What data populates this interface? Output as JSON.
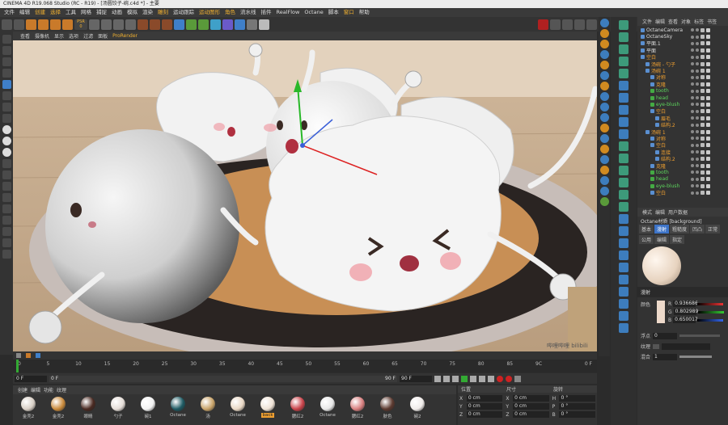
{
  "window": {
    "title": "CINEMA 4D R19.068 Studio (RC - R19) - [汤圆饺子-碗.c4d *] - 主要"
  },
  "menubar": [
    "文件",
    "编辑",
    "创建",
    "选择",
    "工具",
    "网格",
    "捕捉",
    "动画",
    "模拟",
    "渲染",
    "雕刻",
    "运动跟踪",
    "运动图形",
    "角色",
    "流水线",
    "插件",
    "RealFlow",
    "Octane",
    "脚本",
    "窗口",
    "帮助"
  ],
  "menubar_highlight": [
    2,
    3,
    10,
    12,
    13,
    19
  ],
  "toolbar": {
    "psr_label": "PSR",
    "psr_value": "0"
  },
  "viewport": {
    "menu": [
      "查看",
      "摄像机",
      "显示",
      "选项",
      "过滤",
      "面板",
      "ProRender"
    ],
    "menu_highlight": 6,
    "watermark": "哔哩哔哩 bilibili"
  },
  "object_manager": {
    "menu": [
      "文件",
      "编辑",
      "查看",
      "对象",
      "标签",
      "书签"
    ],
    "objects": [
      {
        "name": "OctaneCamera",
        "indent": 0,
        "style": "normal"
      },
      {
        "name": "OctaneSky",
        "indent": 0,
        "style": "normal"
      },
      {
        "name": "平面.1",
        "indent": 0,
        "style": "normal"
      },
      {
        "name": "平面",
        "indent": 0,
        "style": "normal"
      },
      {
        "name": "空白",
        "indent": 0,
        "style": "sel"
      },
      {
        "name": "汤碗 - 勺子",
        "indent": 1,
        "style": "sel"
      },
      {
        "name": "汤碗 1",
        "indent": 1,
        "style": "sel"
      },
      {
        "name": "对称",
        "indent": 2,
        "style": "sel"
      },
      {
        "name": "克隆",
        "indent": 2,
        "style": "sel"
      },
      {
        "name": "tooth",
        "indent": 2,
        "style": "grn"
      },
      {
        "name": "head",
        "indent": 2,
        "style": "grn"
      },
      {
        "name": "eye-blush",
        "indent": 2,
        "style": "grn"
      },
      {
        "name": "空白",
        "indent": 2,
        "style": "sel"
      },
      {
        "name": "眉毛",
        "indent": 3,
        "style": "sel"
      },
      {
        "name": "结构.2",
        "indent": 3,
        "style": "sel"
      },
      {
        "name": "汤碗 1",
        "indent": 1,
        "style": "sel"
      },
      {
        "name": "对称",
        "indent": 2,
        "style": "sel"
      },
      {
        "name": "空白",
        "indent": 2,
        "style": "sel"
      },
      {
        "name": "连接",
        "indent": 3,
        "style": "sel"
      },
      {
        "name": "结构.2",
        "indent": 3,
        "style": "sel"
      },
      {
        "name": "克隆",
        "indent": 2,
        "style": "sel"
      },
      {
        "name": "tooth",
        "indent": 2,
        "style": "grn"
      },
      {
        "name": "head",
        "indent": 2,
        "style": "grn"
      },
      {
        "name": "eye-blush",
        "indent": 2,
        "style": "grn"
      },
      {
        "name": "空白",
        "indent": 2,
        "style": "sel"
      }
    ]
  },
  "attribute_manager": {
    "menu": [
      "模式",
      "编辑",
      "用户数据"
    ],
    "title": "Octane材质 [background]",
    "tabs_row1": [
      "基本",
      "漫射",
      "粗糙度",
      "凹凸",
      "正常"
    ],
    "tabs_row1_active": 1,
    "tabs_row2": [
      "公用",
      "编辑",
      "指定"
    ],
    "section": "漫射",
    "color_label": "颜色",
    "r_label": "R",
    "r_value": "0.936686",
    "g_label": "G",
    "g_value": "0.802989",
    "b_label": "B",
    "b_value": "0.650017",
    "float_label": "浮点",
    "float_value": "0",
    "texture_label": "纹理",
    "mix_label": "混合",
    "mix_value": "1",
    "swatch_color": "#eedacb"
  },
  "timeline": {
    "ticks": [
      "0",
      "5",
      "10",
      "15",
      "20",
      "25",
      "30",
      "35",
      "40",
      "45",
      "50",
      "55",
      "60",
      "65",
      "70",
      "75",
      "80",
      "85",
      "9C"
    ],
    "end_label": "0 F",
    "start_field": "0 F",
    "min_field": "0 F",
    "max_field": "90 F",
    "end_field": "90 F"
  },
  "material_manager": {
    "menu": [
      "创建",
      "编辑",
      "功能",
      "纹理"
    ],
    "materials": [
      {
        "label": "金壳2",
        "color": "#d8cfc6"
      },
      {
        "label": "金壳2",
        "color": "#c98a3c"
      },
      {
        "label": "眼睛",
        "color": "#4a2a22"
      },
      {
        "label": "勺子",
        "color": "#e5ddd8"
      },
      {
        "label": "碗1",
        "color": "#f2f2f2"
      },
      {
        "label": "Octane",
        "color": "#1e5a63"
      },
      {
        "label": "汤",
        "color": "#c9a46a"
      },
      {
        "label": "Octane",
        "color": "#e9d8c5"
      },
      {
        "label": "back",
        "color": "#efe3d6"
      },
      {
        "label": "腮红2",
        "color": "#c9434a"
      },
      {
        "label": "Octane",
        "color": "#e8e8e8"
      },
      {
        "label": "腮红2",
        "color": "#d88080"
      },
      {
        "label": "肤色",
        "color": "#5c3a30"
      },
      {
        "label": "碗2",
        "color": "#f0ecea"
      }
    ],
    "active_index": 8
  },
  "coordinates": {
    "headers": [
      "位置",
      "尺寸",
      "旋转"
    ],
    "rows": [
      {
        "pos_axis": "X",
        "pos": "0 cm",
        "size_axis": "X",
        "size": "0 cm",
        "rot_axis": "H",
        "rot": "0 °"
      },
      {
        "pos_axis": "Y",
        "pos": "0 cm",
        "size_axis": "Y",
        "size": "0 cm",
        "rot_axis": "P",
        "rot": "0 °"
      },
      {
        "pos_axis": "Z",
        "pos": "0 cm",
        "size_axis": "Z",
        "size": "0 cm",
        "rot_axis": "B",
        "rot": "0 °"
      }
    ]
  }
}
